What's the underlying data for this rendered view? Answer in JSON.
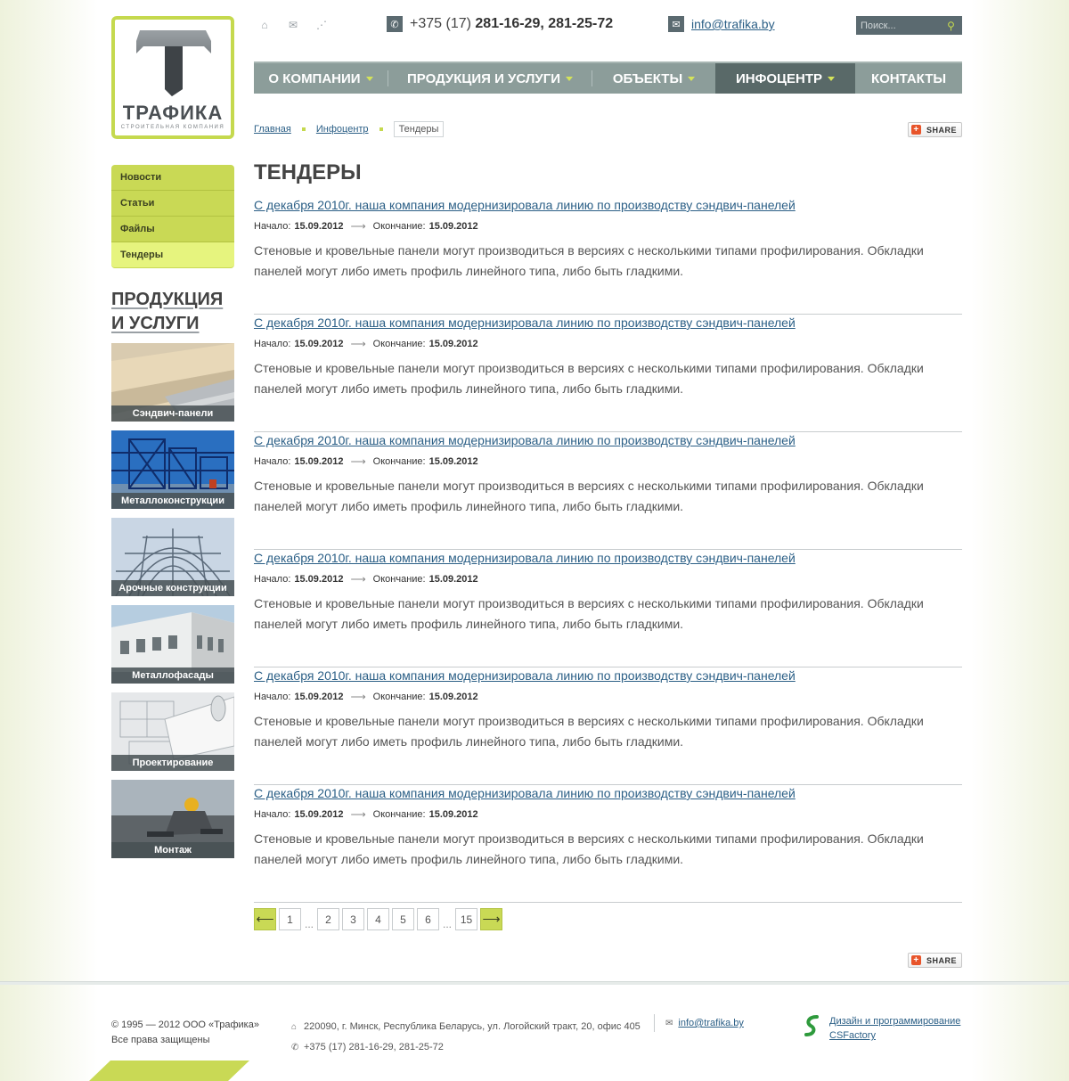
{
  "logo": {
    "brand": "ТРАФИКА",
    "subtitle": "СТРОИТЕЛЬНАЯ КОМПАНИЯ"
  },
  "header": {
    "phone_prefix": "+375 (17)",
    "phone_numbers": "281-16-29, 281-25-72",
    "email": "info@trafika.by",
    "search_placeholder": "Поиск..."
  },
  "nav": {
    "items": [
      {
        "label": "О компании"
      },
      {
        "label": "Продукция и услуги"
      },
      {
        "label": "Объекты"
      },
      {
        "label": "Инфоцентр"
      },
      {
        "label": "Контакты"
      }
    ]
  },
  "breadcrumb": {
    "home": "Главная",
    "section": "Инфоцентр",
    "current": "Тендеры"
  },
  "share_label": "SHARE",
  "sidebar": {
    "menu": [
      "Новости",
      "Статьи",
      "Файлы",
      "Тендеры"
    ],
    "products_title_line1": "Продукция",
    "products_title_line2": "и услуги",
    "products": [
      "Сэндвич-панели",
      "Металлоконструкции",
      "Арочные конструкции",
      "Металлофасады",
      "Проектирование",
      "Монтаж"
    ]
  },
  "page_title": "Тендеры",
  "entries": [
    {
      "title": "С декабря 2010г. наша компания модернизировала линию по производству сэндвич-панелей",
      "start_label": "Начало:",
      "start": "15.09.2012",
      "end_label": "Окончание:",
      "end": "15.09.2012",
      "body": "Стеновые и кровельные панели могут производиться в версиях с несколькими типами профилирования. Обкладки панелей могут либо иметь профиль линейного типа, либо быть гладкими."
    },
    {
      "title": "С декабря 2010г. наша компания модернизировала линию по производству сэндвич-панелей",
      "start_label": "Начало:",
      "start": "15.09.2012",
      "end_label": "Окончание:",
      "end": "15.09.2012",
      "body": "Стеновые и кровельные панели могут производиться в версиях с несколькими типами профилирования. Обкладки панелей могут либо иметь профиль линейного типа, либо быть гладкими."
    },
    {
      "title": "С декабря 2010г. наша компания модернизировала линию по производству сэндвич-панелей",
      "start_label": "Начало:",
      "start": "15.09.2012",
      "end_label": "Окончание:",
      "end": "15.09.2012",
      "body": "Стеновые и кровельные панели могут производиться в версиях с несколькими типами профилирования. Обкладки панелей могут либо иметь профиль линейного типа, либо быть гладкими."
    },
    {
      "title": "С декабря 2010г. наша компания модернизировала линию по производству сэндвич-панелей",
      "start_label": "Начало:",
      "start": "15.09.2012",
      "end_label": "Окончание:",
      "end": "15.09.2012",
      "body": "Стеновые и кровельные панели могут производиться в версиях с несколькими типами профилирования. Обкладки панелей могут либо иметь профиль линейного типа, либо быть гладкими."
    },
    {
      "title": "С декабря 2010г. наша компания модернизировала линию по производству сэндвич-панелей",
      "start_label": "Начало:",
      "start": "15.09.2012",
      "end_label": "Окончание:",
      "end": "15.09.2012",
      "body": "Стеновые и кровельные панели могут производиться в версиях с несколькими типами профилирования. Обкладки панелей могут либо иметь профиль линейного типа, либо быть гладкими."
    },
    {
      "title": "С декабря 2010г. наша компания модернизировала линию по производству сэндвич-панелей",
      "start_label": "Начало:",
      "start": "15.09.2012",
      "end_label": "Окончание:",
      "end": "15.09.2012",
      "body": "Стеновые и кровельные панели могут производиться в версиях с несколькими типами профилирования. Обкладки панелей могут либо иметь профиль линейного типа, либо быть гладкими."
    }
  ],
  "pager": {
    "pages": [
      "1",
      "2",
      "3",
      "4",
      "5",
      "6",
      "15"
    ],
    "ellipsis": "..."
  },
  "footer": {
    "copyright": "© 1995 — 2012 ООО «Трафика»",
    "rights": "Все права защищены",
    "address": "220090, г. Минск, Республика Беларусь, ул. Логойский тракт, 20, офис 405",
    "phone": "+375 (17) 281-16-29, 281-25-72",
    "email": "info@trafika.by",
    "dev_line1": "Дизайн и программирование",
    "dev_line2": "CSFactory"
  },
  "colors": {
    "accent": "#c9d955",
    "nav_bg": "#8c9d9a",
    "nav_active": "#596968",
    "link": "#2b5f86"
  }
}
